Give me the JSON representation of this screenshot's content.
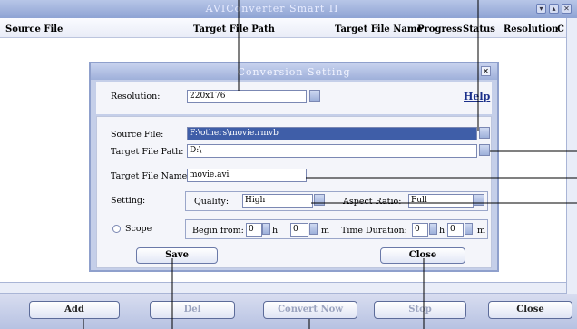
{
  "app": {
    "title": "AVIConverter Smart II"
  },
  "columns": [
    "Source File",
    "Target File Path",
    "Target File Name",
    "Progress",
    "Status",
    "Resolution",
    "C"
  ],
  "dialog": {
    "title": "Conversion Setting",
    "resolution_label": "Resolution:",
    "resolution_value": "220x176",
    "help": "Help",
    "source_label": "Source File:",
    "source_value": "F:\\others\\movie.rmvb",
    "path_label": "Target File Path:",
    "path_value": "D:\\",
    "name_label": "Target File Name:",
    "name_value": "movie.avi",
    "setting_label": "Setting:",
    "quality_label": "Quality:",
    "quality_value": "High",
    "aspect_label": "Aspect Ratio:",
    "aspect_value": "Full",
    "scope_label": "Scope",
    "begin_label": "Begin from:",
    "begin_h": "0",
    "h_unit": "h",
    "begin_m": "0",
    "m_unit": "m",
    "duration_label": "Time Duration:",
    "dur_h": "0",
    "dur_m": "0",
    "save": "Save",
    "close": "Close"
  },
  "toolbar": {
    "add": "Add",
    "del": "Del",
    "convert": "Convert Now",
    "stop": "Stop",
    "close": "Close"
  }
}
